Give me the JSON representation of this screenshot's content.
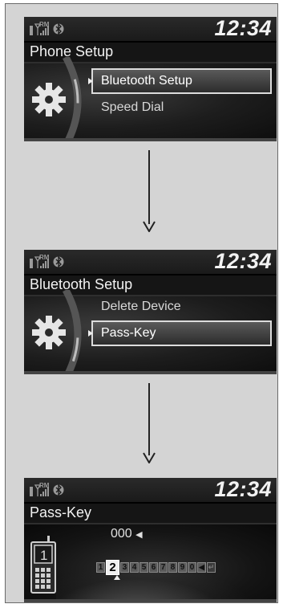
{
  "screens": [
    {
      "clock": "12:34",
      "title": "Phone Setup",
      "items": [
        "Bluetooth Setup",
        "Speed Dial"
      ],
      "selected_index": 0
    },
    {
      "clock": "12:34",
      "title": "Bluetooth Setup",
      "items": [
        "Delete Device",
        "Pass-Key"
      ],
      "selected_index": 1
    },
    {
      "clock": "12:34",
      "title": "Pass-Key",
      "pass_key_value": "000",
      "keypad": [
        "1",
        "2",
        "3",
        "4",
        "5",
        "6",
        "7",
        "8",
        "9",
        "0"
      ],
      "selected_key": "2",
      "phone_screen_digit": "1"
    }
  ],
  "status": {
    "roaming_label": "RM"
  },
  "icons": [
    "signal-icon",
    "bluetooth-icon",
    "gear-icon",
    "phone-icon",
    "back-arrow-icon",
    "enter-icon",
    "down-arrow-icon"
  ],
  "colors": {
    "screen_bg": "#000000",
    "frame_bg": "#d4d4d4",
    "text": "#f2f2f2",
    "selection_border": "#dcdcdc"
  }
}
